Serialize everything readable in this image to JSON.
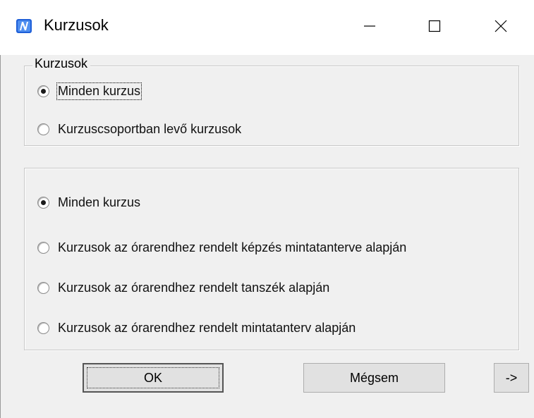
{
  "window": {
    "title": "Kurzusok",
    "controls": {
      "minimize": "—",
      "maximize": "☐",
      "close": "✕"
    }
  },
  "group1": {
    "legend": "Kurzusok",
    "options": [
      {
        "label": "Minden kurzus",
        "checked": true
      },
      {
        "label": "Kurzuscsoportban levő kurzusok",
        "checked": false
      }
    ]
  },
  "group2": {
    "options": [
      {
        "label": "Minden kurzus",
        "checked": true
      },
      {
        "label": "Kurzusok az órarendhez rendelt képzés mintatanterve alapján",
        "checked": false
      },
      {
        "label": "Kurzusok az órarendhez rendelt tanszék alapján",
        "checked": false
      },
      {
        "label": "Kurzusok az órarendhez rendelt mintatanterv alapján",
        "checked": false
      }
    ]
  },
  "buttons": {
    "ok": "OK",
    "cancel": "Mégsem",
    "arrow": "->"
  },
  "colors": {
    "app_icon": "#1e5fd8",
    "window_bg": "#f0f0f0",
    "titlebar_bg": "#ffffff"
  },
  "icons": {
    "app": "app-logo-icon",
    "minimize": "minimize-icon",
    "maximize": "maximize-icon",
    "close": "close-icon"
  }
}
